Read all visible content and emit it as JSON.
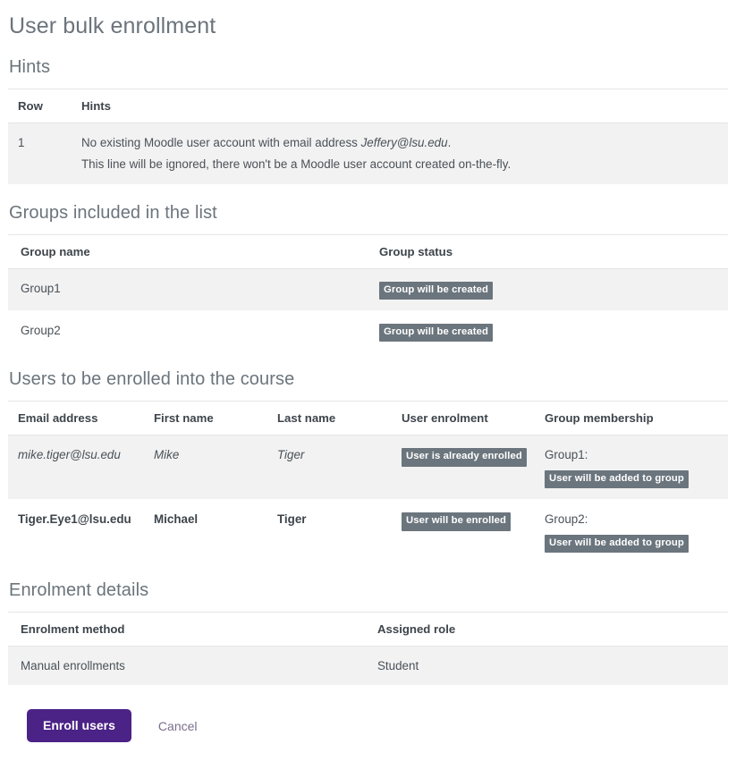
{
  "page": {
    "title": "User bulk enrollment"
  },
  "hints_section": {
    "heading": "Hints",
    "columns": {
      "row": "Row",
      "hints": "Hints"
    },
    "rows": [
      {
        "row": "1",
        "line1_prefix": "No existing Moodle user account with email address ",
        "line1_email": "Jeffery@lsu.edu",
        "line1_suffix": ".",
        "line2": "This line will be ignored, there won't be a Moodle user account created on-the-fly."
      }
    ]
  },
  "groups_section": {
    "heading": "Groups included in the list",
    "columns": {
      "group_name": "Group name",
      "group_status": "Group status"
    },
    "rows": [
      {
        "name": "Group1",
        "status_badge": "Group will be created"
      },
      {
        "name": "Group2",
        "status_badge": "Group will be created"
      }
    ]
  },
  "users_section": {
    "heading": "Users to be enrolled into the course",
    "columns": {
      "email": "Email address",
      "first_name": "First name",
      "last_name": "Last name",
      "user_enrolment": "User enrolment",
      "group_membership": "Group membership"
    },
    "rows": [
      {
        "email": "mike.tiger@lsu.edu",
        "first_name": "Mike",
        "last_name": "Tiger",
        "enrolment_badge": "User is already enrolled",
        "group_name": "Group1:",
        "group_badge": "User will be added to group"
      },
      {
        "email": "Tiger.Eye1@lsu.edu",
        "first_name": "Michael",
        "last_name": "Tiger",
        "enrolment_badge": "User will be enrolled",
        "group_name": "Group2:",
        "group_badge": "User will be added to group"
      }
    ]
  },
  "enrolment_section": {
    "heading": "Enrolment details",
    "columns": {
      "method": "Enrolment method",
      "role": "Assigned role"
    },
    "rows": [
      {
        "method": "Manual enrollments",
        "role": "Student"
      }
    ]
  },
  "actions": {
    "submit_label": "Enroll users",
    "cancel_label": "Cancel"
  },
  "colors": {
    "primary_button": "#4b2286",
    "badge_background": "#6b757d",
    "heading_text": "#6b747c",
    "row_stripe": "#f2f2f2"
  }
}
